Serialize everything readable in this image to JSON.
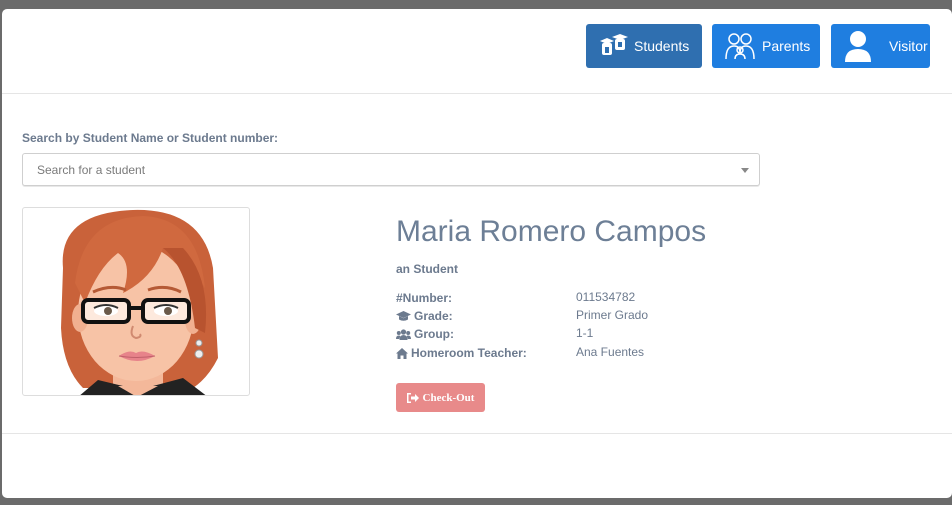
{
  "header": {
    "buttons": [
      {
        "label": "Students",
        "icon": "students-icon",
        "color": "#2f6fb0"
      },
      {
        "label": "Parents",
        "icon": "parents-icon",
        "color": "#1f7ee0"
      },
      {
        "label": "Visitor",
        "icon": "visitor-icon",
        "color": "#1f7ee0"
      }
    ]
  },
  "search": {
    "label": "Search by Student Name or Student number:",
    "placeholder": "Search for a student"
  },
  "student": {
    "name": "Maria Romero Campos",
    "role": "an Student",
    "fields": [
      {
        "key": "#Number:",
        "value": "011534782",
        "icon": "hash-icon"
      },
      {
        "key": "Grade:",
        "value": "Primer Grado",
        "icon": "graduation-cap-icon"
      },
      {
        "key": "Group:",
        "value": "1-1",
        "icon": "users-icon"
      },
      {
        "key": "Homeroom Teacher:",
        "value": "Ana Fuentes",
        "icon": "home-icon"
      }
    ],
    "checkout_label": "Check-Out",
    "checkout_icon": "sign-out-icon",
    "checkout_color": "#e88a8a"
  }
}
